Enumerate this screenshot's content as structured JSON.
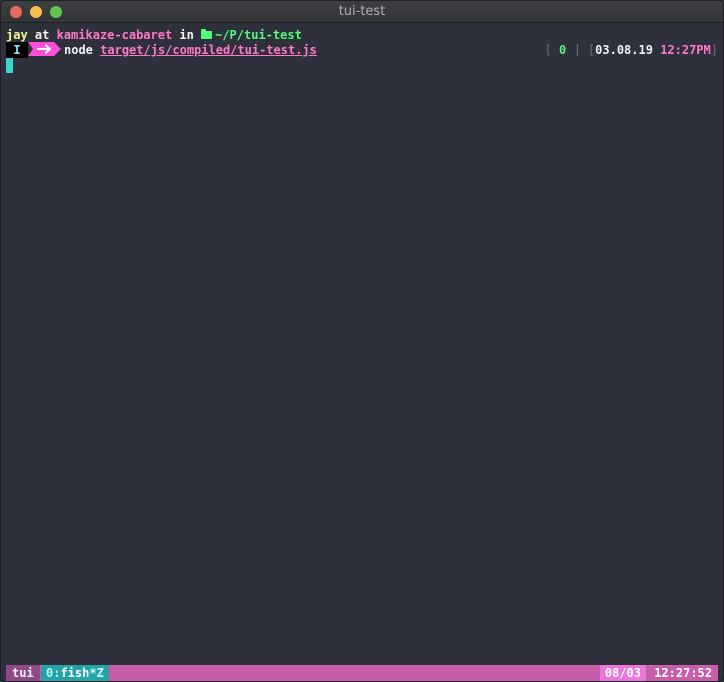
{
  "window": {
    "title": "tui-test"
  },
  "prompt": {
    "user": "jay",
    "at": " at ",
    "host": "kamikaze-cabaret",
    "in": " in ",
    "path": "~/P/tui-test",
    "mode": "I",
    "command": "node",
    "argument": "target/js/compiled/tui-test.js",
    "right": {
      "status": "0",
      "date": "03.08.19",
      "time": "12:27PM"
    }
  },
  "tmux": {
    "session": "tui",
    "window_index": "0:",
    "window_name": "fish",
    "window_flags": "*Z",
    "date": "08/03",
    "time": "12:27:52"
  },
  "colors": {
    "background": "#2e313b",
    "pink": "#ff79c6",
    "green": "#50fa7b",
    "yellow": "#f1fa8c",
    "cyan": "#3fd2d2",
    "statusbar": "#c85da9"
  }
}
